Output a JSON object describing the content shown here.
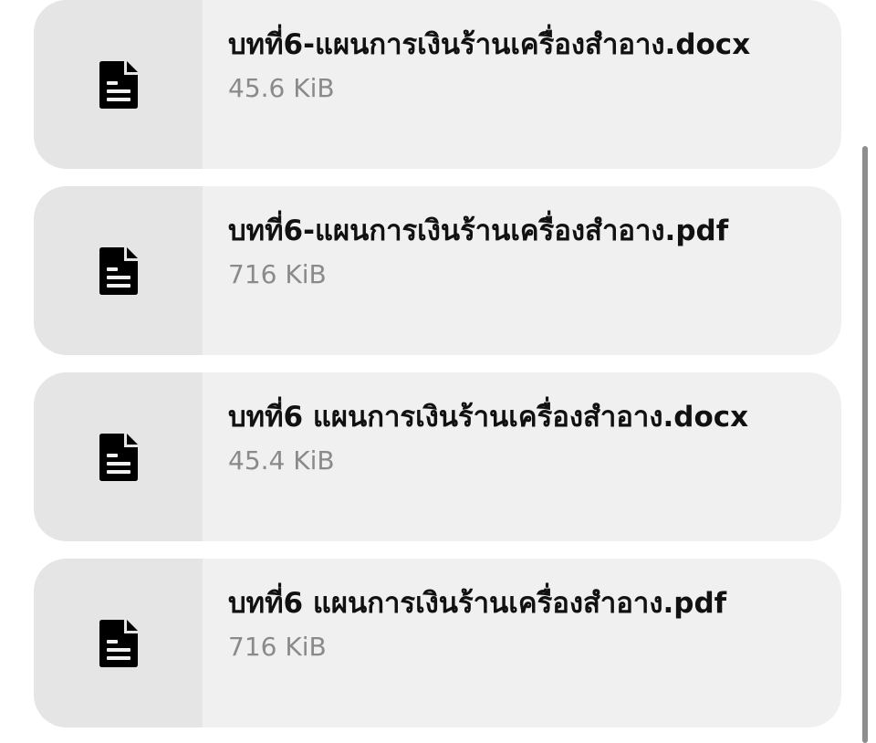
{
  "files": [
    {
      "name": "บทที่6-แผนการเงินร้านเครื่องสำอาง.docx",
      "size": "45.6 KiB",
      "icon": "document-icon"
    },
    {
      "name": "บทที่6-แผนการเงินร้านเครื่องสำอาง.pdf",
      "size": "716 KiB",
      "icon": "document-icon"
    },
    {
      "name": "บทที่6 แผนการเงินร้านเครื่องสำอาง.docx",
      "size": "45.4 KiB",
      "icon": "document-icon"
    },
    {
      "name": "บทที่6 แผนการเงินร้านเครื่องสำอาง.pdf",
      "size": "716 KiB",
      "icon": "document-icon"
    }
  ],
  "colors": {
    "card_background": "#f0f0f0",
    "icon_panel_background": "#e5e5e5",
    "file_name": "#111111",
    "file_size": "#8a8a8a",
    "scrollbar": "#8e8e8e"
  }
}
